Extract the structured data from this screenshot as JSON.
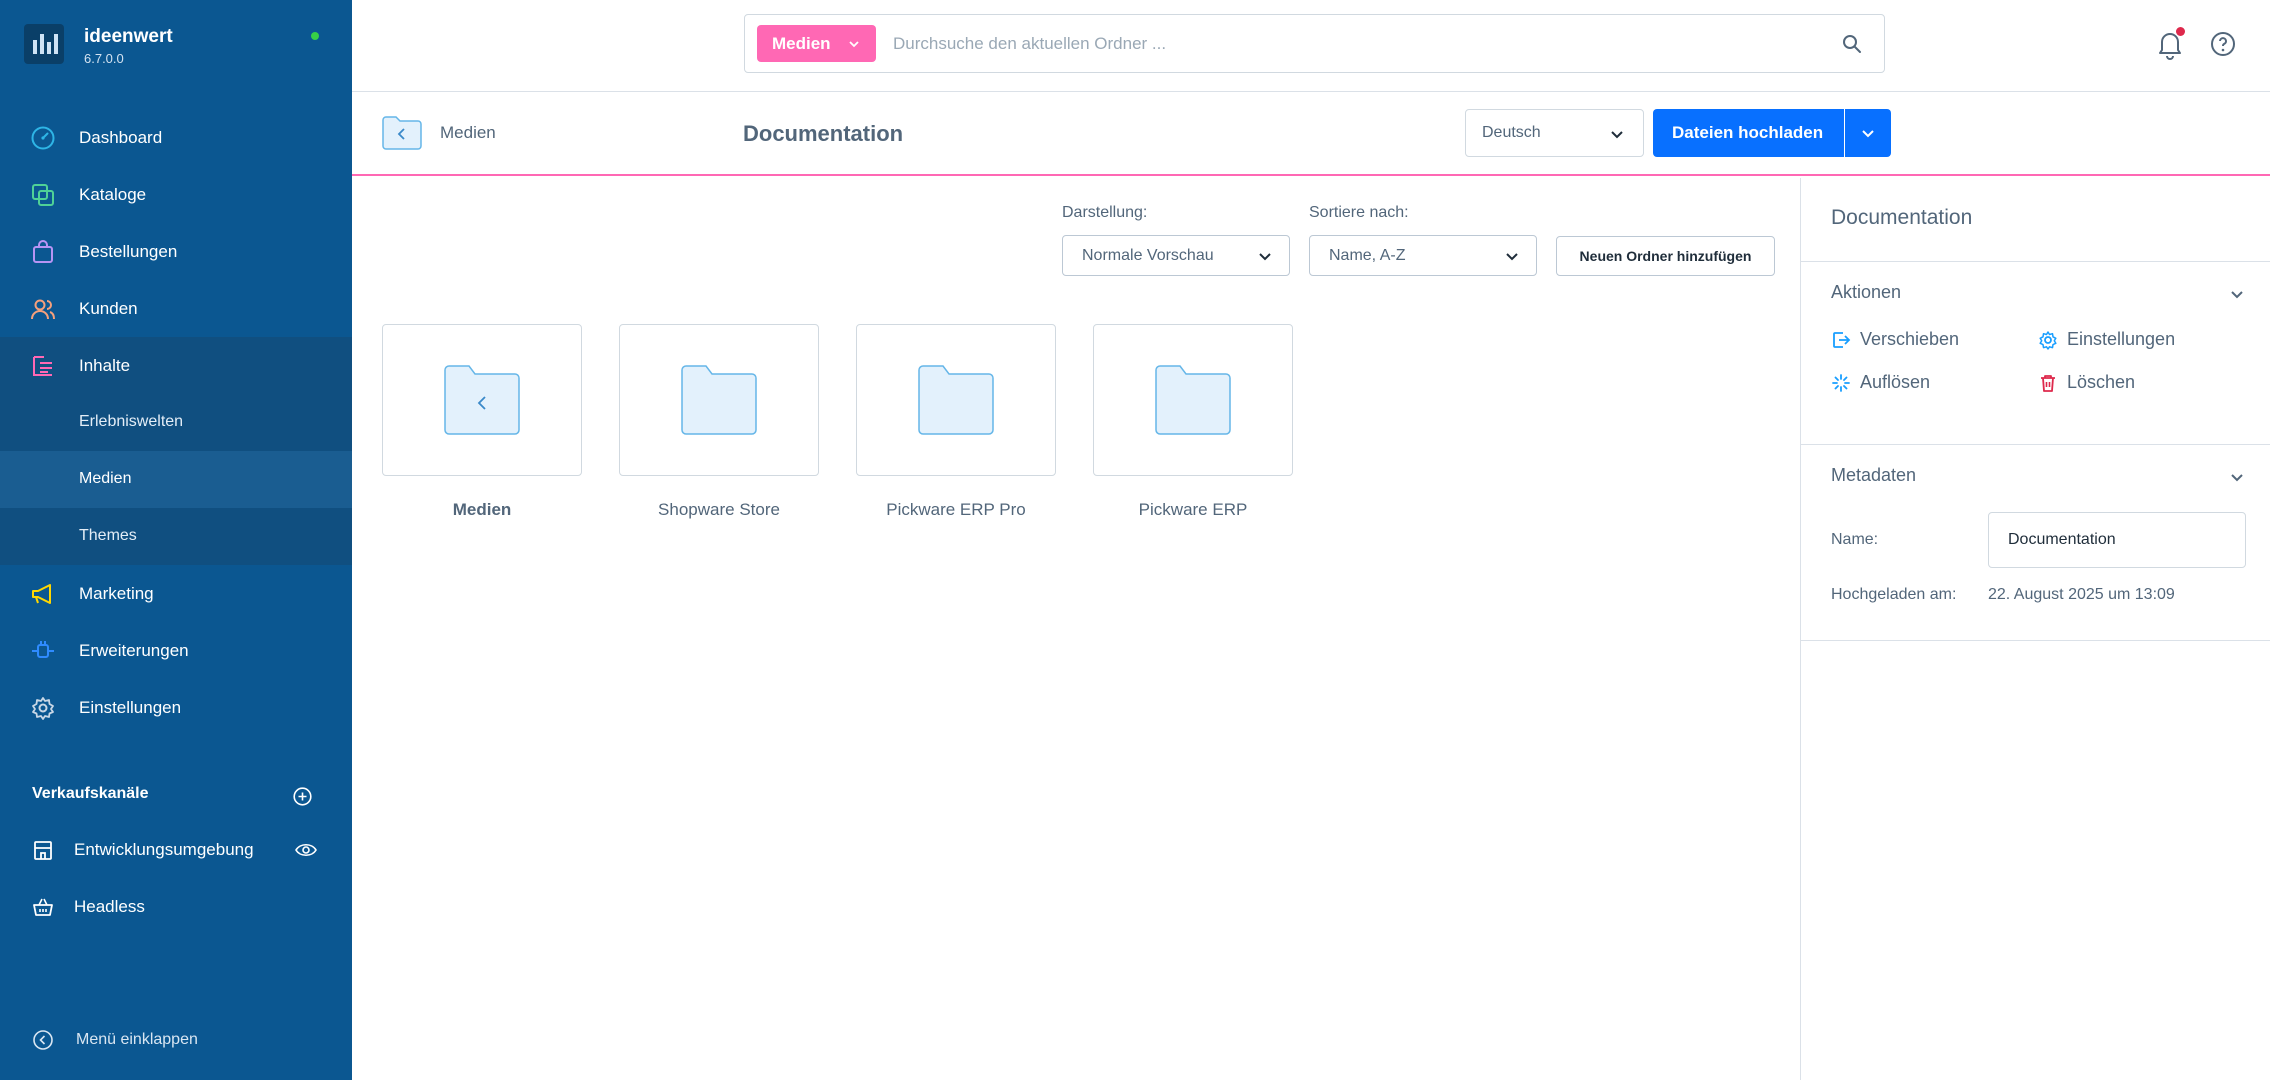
{
  "sidebar": {
    "brand_name": "ideenwert",
    "version": "6.7.0.0",
    "nav": [
      {
        "label": "Dashboard",
        "icon": "gauge-icon",
        "color": "#2eb5e6"
      },
      {
        "label": "Kataloge",
        "icon": "catalog-icon",
        "color": "#4fd197"
      },
      {
        "label": "Bestellungen",
        "icon": "shopping-bag-icon",
        "color": "#b794f4"
      },
      {
        "label": "Kunden",
        "icon": "customers-icon",
        "color": "#f5a07c"
      },
      {
        "label": "Inhalte",
        "icon": "content-icon",
        "color": "#ff68b4"
      }
    ],
    "sub_items": [
      {
        "label": "Erlebniswelten"
      },
      {
        "label": "Medien"
      },
      {
        "label": "Themes"
      }
    ],
    "nav_bottom": [
      {
        "label": "Marketing",
        "icon": "megaphone-icon",
        "color": "#ffd700"
      },
      {
        "label": "Erweiterungen",
        "icon": "plug-icon",
        "color": "#2f8bff"
      },
      {
        "label": "Einstellungen",
        "icon": "gear-icon",
        "color": "#c8d7e6"
      }
    ],
    "sales_channels_title": "Verkaufskanäle",
    "channels": [
      {
        "label": "Entwicklungsumgebung",
        "icon": "storefront-icon"
      },
      {
        "label": "Headless",
        "icon": "basket-icon"
      }
    ],
    "collapse_label": "Menü einklappen"
  },
  "search": {
    "module_tag": "Medien",
    "placeholder": "Durchsuche den aktuellen Ordner ..."
  },
  "smartbar": {
    "back_label": "Medien",
    "title": "Documentation",
    "language": "Deutsch",
    "upload_label": "Dateien hochladen"
  },
  "toolbar": {
    "view_label": "Darstellung:",
    "view_value": "Normale Vorschau",
    "sort_label": "Sortiere nach:",
    "sort_value": "Name, A-Z",
    "new_folder_label": "Neuen Ordner hinzufügen"
  },
  "folders": [
    {
      "name": "Medien",
      "type": "parent"
    },
    {
      "name": "Shopware Store",
      "type": "folder"
    },
    {
      "name": "Pickware ERP Pro",
      "type": "folder"
    },
    {
      "name": "Pickware ERP",
      "type": "folder"
    }
  ],
  "right_panel": {
    "title": "Documentation",
    "actions_title": "Aktionen",
    "actions": [
      {
        "label": "Verschieben",
        "icon": "move-icon",
        "color": "#189eff"
      },
      {
        "label": "Einstellungen",
        "icon": "settings-icon",
        "color": "#189eff"
      },
      {
        "label": "Auflösen",
        "icon": "dissolve-icon",
        "color": "#189eff"
      },
      {
        "label": "Löschen",
        "icon": "trash-icon",
        "color": "#de294c"
      }
    ],
    "metadata_title": "Metadaten",
    "name_label": "Name:",
    "name_value": "Documentation",
    "uploaded_label": "Hochgeladen am:",
    "uploaded_value": "22. August 2025 um 13:09"
  },
  "colors": {
    "sidebar_bg": "#0b5791",
    "accent_pink": "#ff68b4",
    "primary_blue": "#0870ff",
    "folder_fill": "#e3f1fc",
    "folder_stroke": "#65b6e8"
  }
}
